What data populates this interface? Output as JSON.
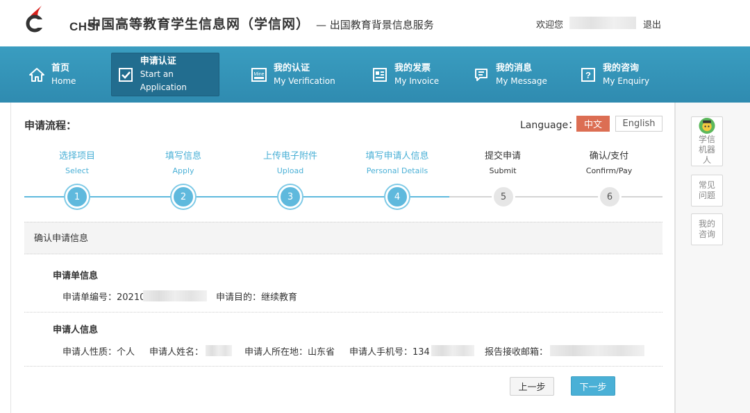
{
  "header": {
    "logo_text": "CHSI",
    "site_title": "中国高等教育学生信息网（学信网）",
    "site_sub": "— 出国教育背景信息服务",
    "welcome": "欢迎您",
    "logout": "退出"
  },
  "nav": {
    "items": [
      {
        "cn": "首页",
        "en": "Home",
        "icon": "home-icon"
      },
      {
        "cn": "申请认证",
        "en": "Start an Application",
        "icon": "apply-icon"
      },
      {
        "cn": "我的认证",
        "en": "My Verification",
        "icon": "mine-icon"
      },
      {
        "cn": "我的发票",
        "en": "My Invoice",
        "icon": "invoice-icon"
      },
      {
        "cn": "我的消息",
        "en": "My Message",
        "icon": "message-icon"
      },
      {
        "cn": "我的咨询",
        "en": "My Enquiry",
        "icon": "enquiry-icon"
      }
    ]
  },
  "main": {
    "process_title": "申请流程：",
    "language_label": "Language：",
    "lang_cn": "中文",
    "lang_en": "English",
    "steps": [
      {
        "cn": "选择项目",
        "en": "Select",
        "num": "1",
        "status": "done"
      },
      {
        "cn": "填写信息",
        "en": "Apply",
        "num": "2",
        "status": "done"
      },
      {
        "cn": "上传电子附件",
        "en": "Upload",
        "num": "3",
        "status": "done"
      },
      {
        "cn": "填写申请人信息",
        "en": "Personal Details",
        "num": "4",
        "status": "done"
      },
      {
        "cn": "提交申请",
        "en": "Submit",
        "num": "5",
        "status": "todo"
      },
      {
        "cn": "确认/支付",
        "en": "Confirm/Pay",
        "num": "6",
        "status": "todo"
      }
    ],
    "section_title": "确认申请信息",
    "order_block_title": "申请单信息",
    "order_no_label": "申请单编号：20210",
    "purpose": "申请目的：继续教育",
    "applicant_block_title": "申请人信息",
    "applicant_type": "申请人性质：个人",
    "applicant_name_label": "申请人姓名：",
    "applicant_location": "申请人所在地：山东省",
    "applicant_phone_label": "申请人手机号：134",
    "email_label": "报告接收邮箱：",
    "prev_button": "上一步",
    "next_button": "下一步"
  },
  "side": {
    "robot_label": "学信机器人",
    "faq_label": "常见问题",
    "consult_label": "我的咨询"
  },
  "colors": {
    "nav_bg": "#3a9dc0",
    "nav_active": "#226d8f",
    "step_done": "#4ab0d6",
    "lang_active": "#dc6e53"
  }
}
